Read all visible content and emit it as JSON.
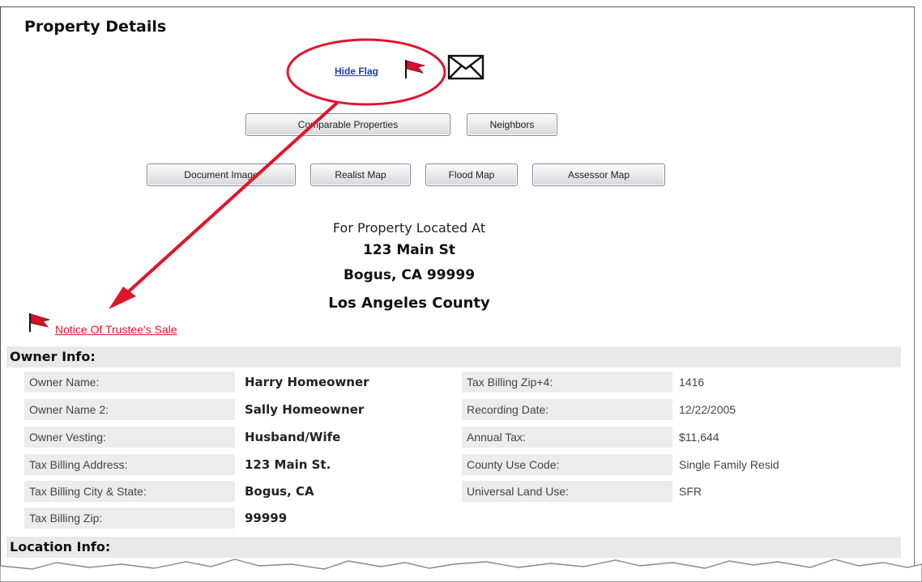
{
  "page": {
    "title": "Property Details",
    "hide_flag_label": "Hide Flag"
  },
  "buttons": {
    "comparable": "Comparable Properties",
    "neighbors": "Neighbors",
    "document_image": "Document Image",
    "realist_map": "Realist Map",
    "flood_map": "Flood Map",
    "assessor_map": "Assessor Map"
  },
  "location": {
    "label": "For Property Located At",
    "street": "123 Main St",
    "city_state_zip": "Bogus, CA 99999",
    "county": "Los Angeles County"
  },
  "notice": {
    "label": "Notice Of Trustee's Sale"
  },
  "owner_info": {
    "heading": "Owner Info:",
    "rows": [
      {
        "l1": "Owner Name:",
        "v1": "Harry Homeowner",
        "l2": "Tax Billing Zip+4:",
        "v2": "1416"
      },
      {
        "l1": "Owner Name 2:",
        "v1": "Sally Homeowner",
        "l2": "Recording Date:",
        "v2": "12/22/2005"
      },
      {
        "l1": "Owner Vesting:",
        "v1": "Husband/Wife",
        "l2": "Annual Tax:",
        "v2": "$11,644"
      },
      {
        "l1": "Tax Billing Address:",
        "v1": "123 Main St.",
        "l2": "County Use Code:",
        "v2": "Single Family Resid"
      },
      {
        "l1": "Tax Billing City & State:",
        "v1": "Bogus, CA",
        "l2": "Universal Land Use:",
        "v2": "SFR"
      },
      {
        "l1": "Tax Billing Zip:",
        "v1": "99999",
        "l2": "",
        "v2": ""
      }
    ]
  },
  "location_info": {
    "heading": "Location Info:"
  },
  "colors": {
    "annotation_red": "#e0152a",
    "link_blue": "#1a3fb0",
    "section_bg": "#e9e9e9"
  },
  "icons": [
    "flag-icon",
    "envelope-icon"
  ]
}
